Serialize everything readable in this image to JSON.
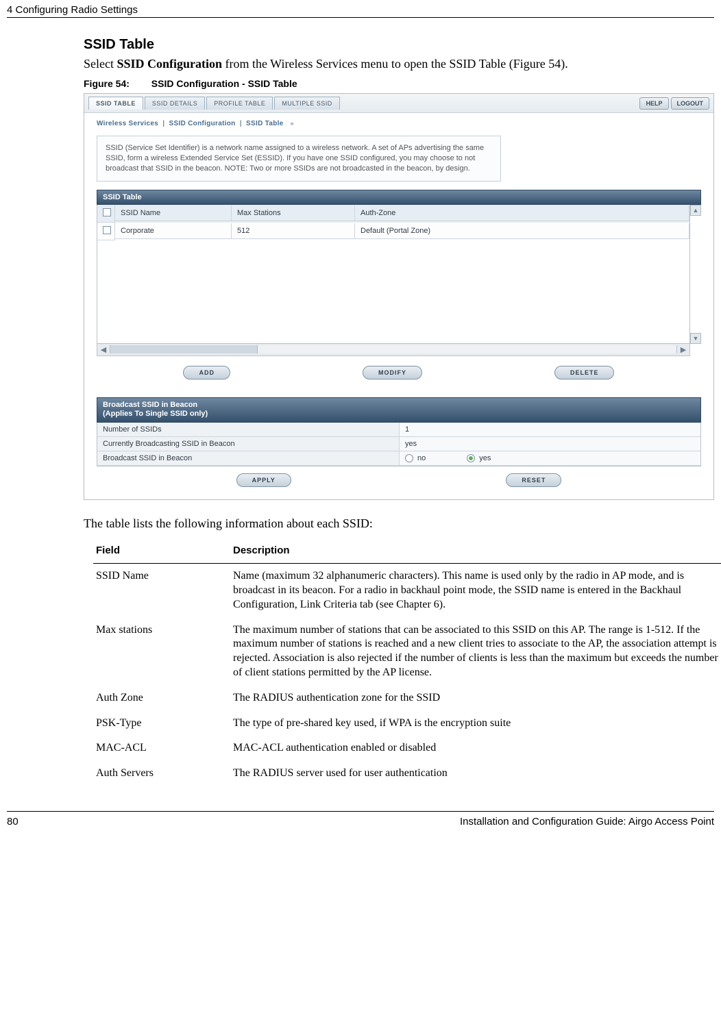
{
  "header": {
    "left": "4  Configuring Radio Settings"
  },
  "subsection": "SSID Table",
  "intro_parts": {
    "p1": "Select ",
    "bold": "SSID Configuration",
    "p2": " from the Wireless Services menu to open the SSID Table (Figure 54)."
  },
  "figure": {
    "num": "Figure 54:",
    "cap": "SSID Configuration - SSID Table"
  },
  "screenshot": {
    "tabs": [
      "SSID TABLE",
      "SSID DETAILS",
      "PROFILE TABLE",
      "MULTIPLE SSID"
    ],
    "top_buttons": [
      "HELP",
      "LOGOUT"
    ],
    "breadcrumb": [
      "Wireless Services",
      "SSID Configuration",
      "SSID Table"
    ],
    "note": "SSID (Service Set Identifier) is a network name assigned to a wireless network. A set of APs advertising the same SSID, form a wireless Extended Service Set (ESSID). If you have one SSID configured, you may choose to not broadcast that SSID in the beacon. NOTE: Two or more SSIDs are not broadcasted in the beacon, by design.",
    "table": {
      "title": "SSID Table",
      "cols": [
        "SSID Name",
        "Max Stations",
        "Auth-Zone"
      ],
      "rows": [
        {
          "name": "Corporate",
          "max": "512",
          "zone": "Default (Portal Zone)"
        }
      ],
      "action_buttons": [
        "ADD",
        "MODIFY",
        "DELETE"
      ]
    },
    "broadcast": {
      "title_l1": "Broadcast SSID in Beacon",
      "title_l2": "(Applies To Single SSID only)",
      "rows": {
        "num_ssids_label": "Number of SSIDs",
        "num_ssids_val": "1",
        "currently_label": "Currently Broadcasting SSID in Beacon",
        "currently_val": "yes",
        "broadcast_label": "Broadcast SSID in Beacon",
        "opt_no": "no",
        "opt_yes": "yes",
        "selected": "yes"
      },
      "buttons": [
        "APPLY",
        "RESET"
      ]
    }
  },
  "post_text": "The table lists the following information about each SSID:",
  "fd_table": {
    "head": {
      "field": "Field",
      "desc": "Description"
    },
    "rows": [
      {
        "field": "SSID Name",
        "desc": "Name (maximum 32 alphanumeric characters). This name is used only by the radio in AP mode, and is broadcast in its beacon. For a radio in backhaul point mode, the SSID name is entered in the Backhaul Configuration, Link Criteria tab (see Chapter 6)."
      },
      {
        "field": "Max stations",
        "desc": "The maximum number of stations that can be associated to this SSID on this AP. The range is 1-512. If the maximum number of stations is reached and a new client tries to associate to the AP, the association attempt is rejected. Association is also rejected if the number of clients is less than the maximum but exceeds the number of client stations permitted by the AP license."
      },
      {
        "field": "Auth Zone",
        "desc": "The RADIUS authentication zone for the SSID"
      },
      {
        "field": "PSK-Type",
        "desc": "The type of pre-shared key used, if WPA is the encryption suite"
      },
      {
        "field": "MAC-ACL",
        "desc": "MAC-ACL authentication enabled or disabled"
      },
      {
        "field": "Auth Servers",
        "desc": "The RADIUS server used for user authentication"
      }
    ]
  },
  "footer": {
    "left": "80",
    "right": "Installation and Configuration Guide: Airgo Access Point"
  }
}
